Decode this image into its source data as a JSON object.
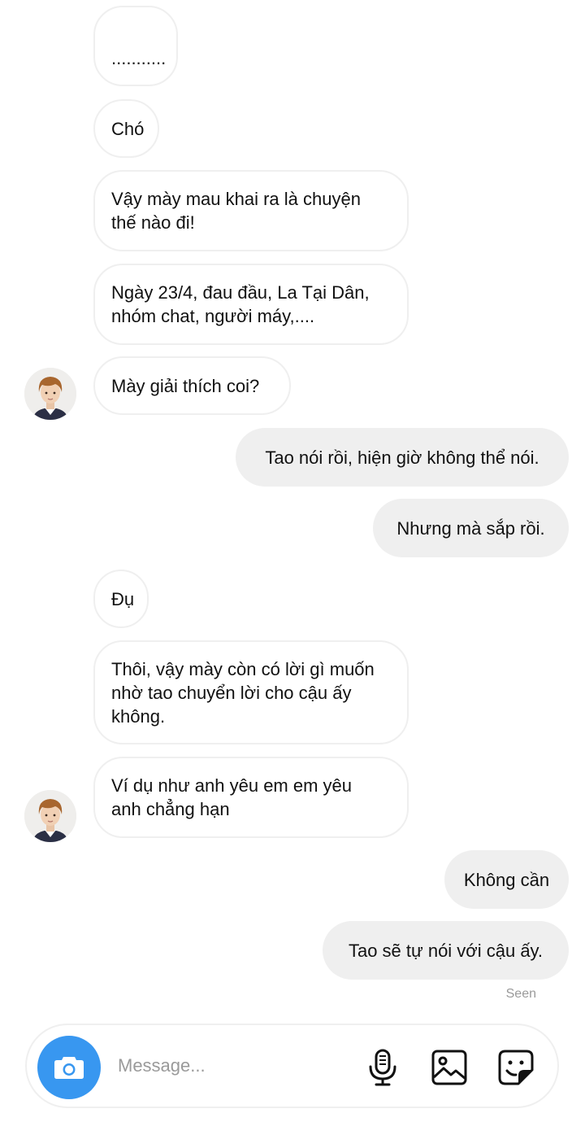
{
  "messages": [
    {
      "text": "..........."
    },
    {
      "text": "Chó"
    },
    {
      "text": "Vậy mày mau khai ra là chuyện\nthế nào đi!"
    },
    {
      "text": "Ngày 23/4, đau đầu, La Tại Dân,\nnhóm chat, người máy,...."
    },
    {
      "text": "Mày giải thích coi?"
    },
    {
      "text": "Tao nói rồi, hiện giờ không thể nói."
    },
    {
      "text": "Nhưng mà sắp rồi."
    },
    {
      "text": "Đụ"
    },
    {
      "text": "Thôi, vậy mày còn có lời gì muốn\nnhờ tao chuyển lời cho cậu ấy\nkhông."
    },
    {
      "text": "Ví dụ như anh yêu em em yêu\nanh chẳng hạn"
    },
    {
      "text": "Không cần"
    },
    {
      "text": "Tao sẽ tự nói với cậu ấy."
    }
  ],
  "status": {
    "seen": "Seen"
  },
  "composer": {
    "placeholder": "Message...",
    "icons": {
      "camera": "camera-icon",
      "mic": "microphone-icon",
      "gallery": "gallery-icon",
      "sticker": "sticker-icon"
    },
    "accent_color": "#3897f0"
  }
}
